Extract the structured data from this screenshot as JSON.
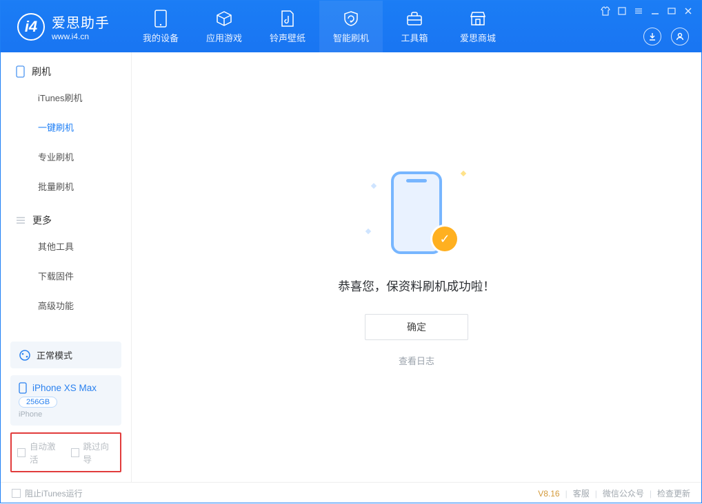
{
  "app": {
    "title": "爱思助手",
    "subtitle": "www.i4.cn"
  },
  "nav": {
    "items": [
      {
        "label": "我的设备"
      },
      {
        "label": "应用游戏"
      },
      {
        "label": "铃声壁纸"
      },
      {
        "label": "智能刷机"
      },
      {
        "label": "工具箱"
      },
      {
        "label": "爱思商城"
      }
    ]
  },
  "sidebar": {
    "section1": {
      "title": "刷机"
    },
    "items1": [
      {
        "label": "iTunes刷机"
      },
      {
        "label": "一键刷机"
      },
      {
        "label": "专业刷机"
      },
      {
        "label": "批量刷机"
      }
    ],
    "section2": {
      "title": "更多"
    },
    "items2": [
      {
        "label": "其他工具"
      },
      {
        "label": "下载固件"
      },
      {
        "label": "高级功能"
      }
    ],
    "mode_label": "正常模式",
    "device": {
      "name": "iPhone XS Max",
      "capacity": "256GB",
      "type": "iPhone"
    },
    "checkboxes": {
      "auto_activate": "自动激活",
      "skip_wizard": "跳过向导"
    }
  },
  "main": {
    "message": "恭喜您，保资料刷机成功啦！",
    "ok_label": "确定",
    "view_log": "查看日志"
  },
  "footer": {
    "block_itunes": "阻止iTunes运行",
    "version": "V8.16",
    "support": "客服",
    "wechat": "微信公众号",
    "update": "检查更新"
  }
}
